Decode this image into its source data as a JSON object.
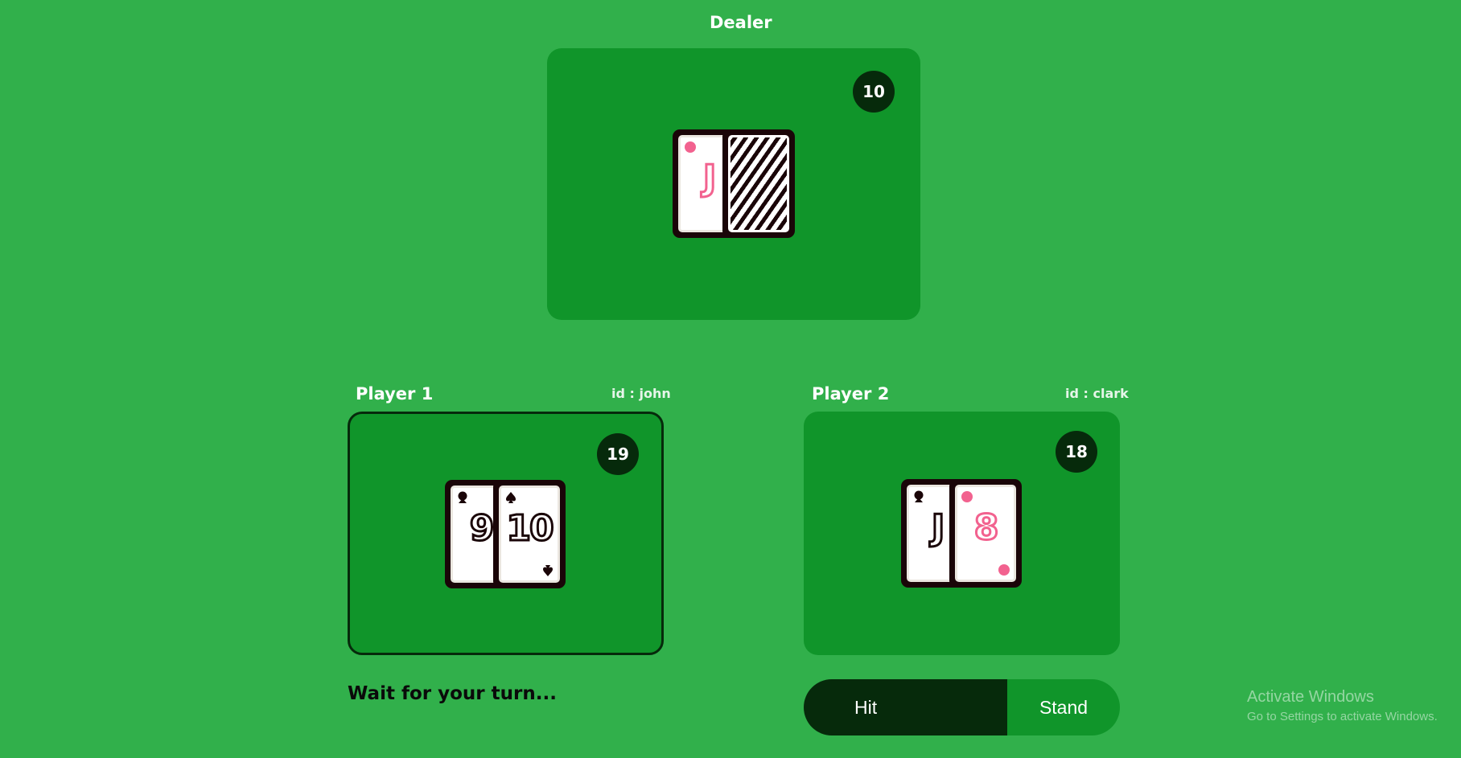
{
  "dealer": {
    "title": "Dealer",
    "score": "10",
    "cards": [
      {
        "rank": "J",
        "suit": "heart",
        "color": "red",
        "face_down": false
      },
      {
        "rank": "",
        "suit": "",
        "color": "",
        "face_down": true
      }
    ]
  },
  "players": [
    {
      "title": "Player 1",
      "id_label": "id : john",
      "score": "19",
      "active": true,
      "cards": [
        {
          "rank": "9",
          "suit": "club",
          "color": "black"
        },
        {
          "rank": "10",
          "suit": "spade",
          "color": "black"
        }
      ]
    },
    {
      "title": "Player 2",
      "id_label": "id : clark",
      "score": "18",
      "active": false,
      "cards": [
        {
          "rank": "J",
          "suit": "club",
          "color": "black"
        },
        {
          "rank": "8",
          "suit": "heart",
          "color": "red"
        }
      ]
    }
  ],
  "status": {
    "text": "Wait for your turn..."
  },
  "controls": {
    "hit_label": "Hit",
    "stand_label": "Stand"
  },
  "watermark": {
    "title": "Activate Windows",
    "subtitle": "Go to Settings to activate Windows."
  },
  "colors": {
    "background": "#31b04b",
    "table": "#10952a",
    "dark": "#062a0b",
    "card_red": "#f2628f",
    "card_black": "#1a0508"
  }
}
